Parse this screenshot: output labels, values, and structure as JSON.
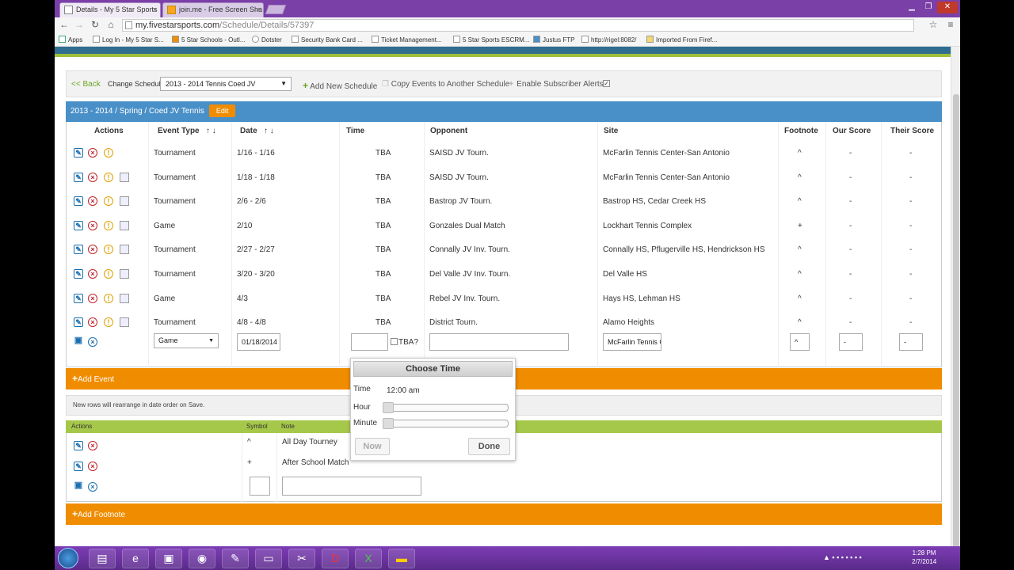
{
  "browser": {
    "tabs": [
      {
        "title": "Details - My 5 Star Sports"
      },
      {
        "title": "join.me - Free Screen Sha"
      }
    ],
    "url": {
      "host": "my.fivestarsports.com",
      "path": "/Schedule/Details/57397"
    },
    "bookmarks": [
      "Apps",
      "Log In - My 5 Star S...",
      "5 Star Schools - Outl...",
      "Dotster",
      "Security Bank Card ...",
      "Ticket Management...",
      "5 Star Sports ESCRM...",
      "Justus FTP",
      "http://rigel:8082/",
      "Imported From Firef..."
    ]
  },
  "toolbar": {
    "back": "<< Back",
    "change_schedule_label": "Change Schedule:",
    "schedule_value": "2013 - 2014 Tennis Coed JV",
    "add_schedule": "Add New Schedule",
    "copy_events": "Copy Events to Another Schedule",
    "enable_alerts": "Enable Subscriber Alerts",
    "alerts_checked": "✓"
  },
  "grid": {
    "header": "2013 - 2014 / Spring / Coed JV Tennis",
    "edit": "Edit",
    "columns": {
      "actions": "Actions",
      "event_type": "Event Type",
      "date": "Date",
      "time": "Time",
      "opponent": "Opponent",
      "site": "Site",
      "footnote": "Footnote",
      "our_score": "Our Score",
      "their_score": "Their Score"
    },
    "sort_arrows": "↑ ↓",
    "rows": [
      {
        "type": "Tournament",
        "date": "1/16 - 1/16",
        "time": "TBA",
        "opponent": "SAISD JV Tourn.",
        "site": "McFarlin Tennis Center-San Antonio",
        "footnote": "^",
        "our": "-",
        "their": "-",
        "img": false
      },
      {
        "type": "Tournament",
        "date": "1/18 - 1/18",
        "time": "TBA",
        "opponent": "SAISD JV Tourn.",
        "site": "McFarlin Tennis Center-San Antonio",
        "footnote": "^",
        "our": "-",
        "their": "-",
        "img": true
      },
      {
        "type": "Tournament",
        "date": "2/6 - 2/6",
        "time": "TBA",
        "opponent": "Bastrop JV Tourn.",
        "site": "Bastrop HS, Cedar Creek HS",
        "footnote": "^",
        "our": "-",
        "their": "-",
        "img": true
      },
      {
        "type": "Game",
        "date": "2/10",
        "time": "TBA",
        "opponent": "Gonzales Dual Match",
        "site": "Lockhart Tennis Complex",
        "footnote": "+",
        "our": "-",
        "their": "-",
        "img": true
      },
      {
        "type": "Tournament",
        "date": "2/27 - 2/27",
        "time": "TBA",
        "opponent": "Connally JV Inv. Tourn.",
        "site": "Connally HS, Pflugerville HS, Hendrickson HS",
        "footnote": "^",
        "our": "-",
        "their": "-",
        "img": true
      },
      {
        "type": "Tournament",
        "date": "3/20 - 3/20",
        "time": "TBA",
        "opponent": "Del Valle JV Inv. Tourn.",
        "site": "Del Valle HS",
        "footnote": "^",
        "our": "-",
        "their": "-",
        "img": true
      },
      {
        "type": "Game",
        "date": "4/3",
        "time": "TBA",
        "opponent": "Rebel JV Inv. Tourn.",
        "site": "Hays HS, Lehman HS",
        "footnote": "^",
        "our": "-",
        "their": "-",
        "img": true
      },
      {
        "type": "Tournament",
        "date": "4/8 - 4/8",
        "time": "TBA",
        "opponent": "District Tourn.",
        "site": "Alamo Heights",
        "footnote": "^",
        "our": "-",
        "their": "-",
        "img": true
      }
    ],
    "new_row": {
      "type": "Game",
      "date": "01/18/2014",
      "tba": "TBA?",
      "site": "McFarlin Tennis C",
      "footnote": "^",
      "our": "-",
      "their": "-"
    }
  },
  "add_event": "Add Event",
  "note": "New rows will rearrange in date order on Save.",
  "footnotes": {
    "columns": {
      "actions": "Actions",
      "symbol": "Symbol",
      "note": "Note"
    },
    "rows": [
      {
        "symbol": "^",
        "note": "All Day Tourney"
      },
      {
        "symbol": "+",
        "note": "After School Match"
      }
    ],
    "add": "Add Footnote"
  },
  "time_picker": {
    "title": "Choose Time",
    "time_label": "Time",
    "time_value": "12:00 am",
    "hour": "Hour",
    "minute": "Minute",
    "now": "Now",
    "done": "Done",
    "hour_value": 0,
    "minute_value": 0
  },
  "taskbar": {
    "time": "1:28 PM",
    "date": "2/7/2014"
  }
}
